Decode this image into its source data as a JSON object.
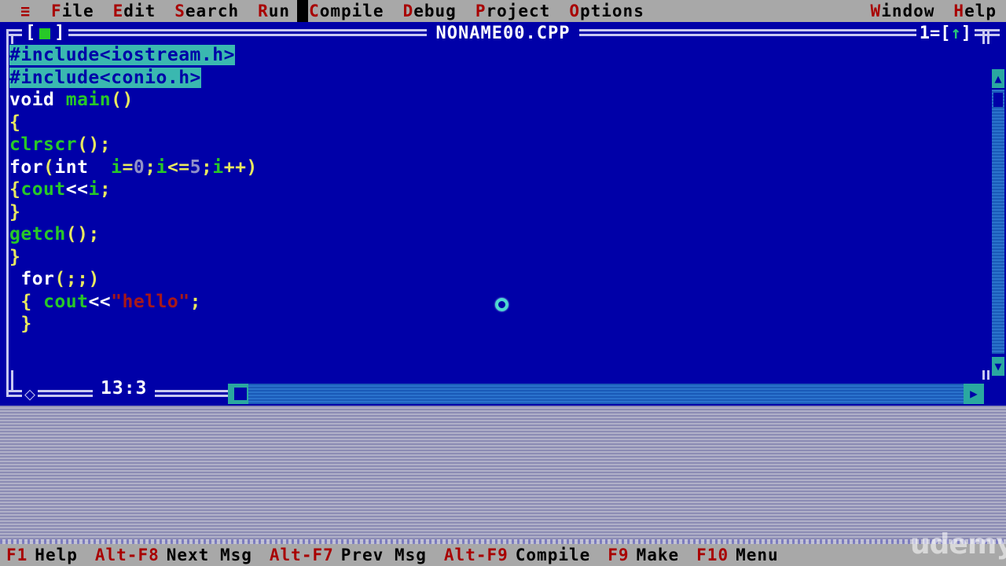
{
  "menubar": {
    "hamburger": "≡",
    "items": [
      {
        "name": "file",
        "hot": "F",
        "rest": "ile"
      },
      {
        "name": "edit",
        "hot": "E",
        "rest": "dit"
      },
      {
        "name": "search",
        "hot": "S",
        "rest": "earch"
      },
      {
        "name": "run",
        "hot": "R",
        "rest": "un"
      },
      {
        "name": "compile",
        "hot": "C",
        "rest": "ompile"
      },
      {
        "name": "debug",
        "hot": "D",
        "rest": "ebug"
      },
      {
        "name": "project",
        "hot": "P",
        "rest": "roject"
      },
      {
        "name": "options",
        "hot": "O",
        "rest": "ptions"
      }
    ],
    "right_items": [
      {
        "name": "window",
        "hot": "W",
        "rest": "indow"
      },
      {
        "name": "help",
        "hot": "H",
        "rest": "elp"
      }
    ]
  },
  "window": {
    "title": "NONAME00.CPP",
    "number": "1",
    "maximize_glyph": "↑",
    "close_left": "[",
    "close_right": "]",
    "cursor_position": "13:3",
    "resize_glyph": "⬦"
  },
  "code": {
    "lines": [
      {
        "tokens": [
          {
            "t": "#include<iostream.h>",
            "c": "tk-pre"
          }
        ]
      },
      {
        "tokens": [
          {
            "t": "#include<conio.h>",
            "c": "tk-pre"
          }
        ]
      },
      {
        "tokens": [
          {
            "t": "void ",
            "c": "tk-kw"
          },
          {
            "t": "main",
            "c": "tk-id"
          },
          {
            "t": "()",
            "c": "tk-punc"
          }
        ]
      },
      {
        "tokens": [
          {
            "t": "{",
            "c": "tk-punc"
          }
        ]
      },
      {
        "tokens": [
          {
            "t": "clrscr",
            "c": "tk-id"
          },
          {
            "t": "();",
            "c": "tk-punc"
          }
        ]
      },
      {
        "tokens": [
          {
            "t": "for",
            "c": "tk-kw"
          },
          {
            "t": "(",
            "c": "tk-punc"
          },
          {
            "t": "int ",
            "c": "tk-kw"
          },
          {
            "t": " i",
            "c": "tk-id"
          },
          {
            "t": "=",
            "c": "tk-punc"
          },
          {
            "t": "0",
            "c": "tk-num"
          },
          {
            "t": ";",
            "c": "tk-punc"
          },
          {
            "t": "i",
            "c": "tk-id"
          },
          {
            "t": "<=",
            "c": "tk-punc"
          },
          {
            "t": "5",
            "c": "tk-num"
          },
          {
            "t": ";",
            "c": "tk-punc"
          },
          {
            "t": "i",
            "c": "tk-id"
          },
          {
            "t": "++)",
            "c": "tk-punc"
          }
        ]
      },
      {
        "tokens": [
          {
            "t": "{",
            "c": "tk-punc"
          },
          {
            "t": "cout",
            "c": "tk-id"
          },
          {
            "t": "<<",
            "c": "tk-kw"
          },
          {
            "t": "i",
            "c": "tk-id"
          },
          {
            "t": ";",
            "c": "tk-punc"
          }
        ]
      },
      {
        "tokens": [
          {
            "t": "}",
            "c": "tk-punc"
          }
        ]
      },
      {
        "tokens": [
          {
            "t": "getch",
            "c": "tk-id"
          },
          {
            "t": "();",
            "c": "tk-punc"
          }
        ]
      },
      {
        "tokens": [
          {
            "t": "}",
            "c": "tk-punc"
          }
        ]
      },
      {
        "tokens": [
          {
            "t": " ",
            "c": "tk-plain"
          },
          {
            "t": "for",
            "c": "tk-kw"
          },
          {
            "t": "(;;)",
            "c": "tk-punc"
          }
        ]
      },
      {
        "tokens": [
          {
            "t": " ",
            "c": "tk-plain"
          },
          {
            "t": "{ ",
            "c": "tk-punc"
          },
          {
            "t": "cout",
            "c": "tk-id"
          },
          {
            "t": "<<",
            "c": "tk-kw"
          },
          {
            "t": "\"hello\"",
            "c": "tk-str"
          },
          {
            "t": ";",
            "c": "tk-punc"
          }
        ]
      },
      {
        "tokens": [
          {
            "t": " ",
            "c": "tk-plain"
          },
          {
            "t": "}",
            "c": "tk-punc"
          }
        ]
      }
    ]
  },
  "scrollbars": {
    "up_arrow": "▲",
    "down_arrow": "▼",
    "left_arrow": "◀",
    "right_arrow": "▶"
  },
  "statusbar": {
    "hints": [
      {
        "key": "F1",
        "desc": "Help"
      },
      {
        "key": "Alt-F8",
        "desc": "Next Msg"
      },
      {
        "key": "Alt-F7",
        "desc": "Prev Msg"
      },
      {
        "key": "Alt-F9",
        "desc": "Compile"
      },
      {
        "key": "F9",
        "desc": "Make"
      },
      {
        "key": "F10",
        "desc": "Menu"
      }
    ]
  },
  "watermark": {
    "text": "udemy"
  },
  "colors": {
    "menubar_bg": "#a8a8a8",
    "hotkey_red": "#a80000",
    "window_bg": "#0000a8",
    "frame": "#c8c8f0",
    "highlight_bg": "#3ab8b0",
    "identifier_green": "#28c828",
    "punctuation_yellow": "#e8e860",
    "string_red": "#a81818",
    "number_gray": "#9090c8",
    "scrollbar_arrow": "#2aa8a0"
  }
}
